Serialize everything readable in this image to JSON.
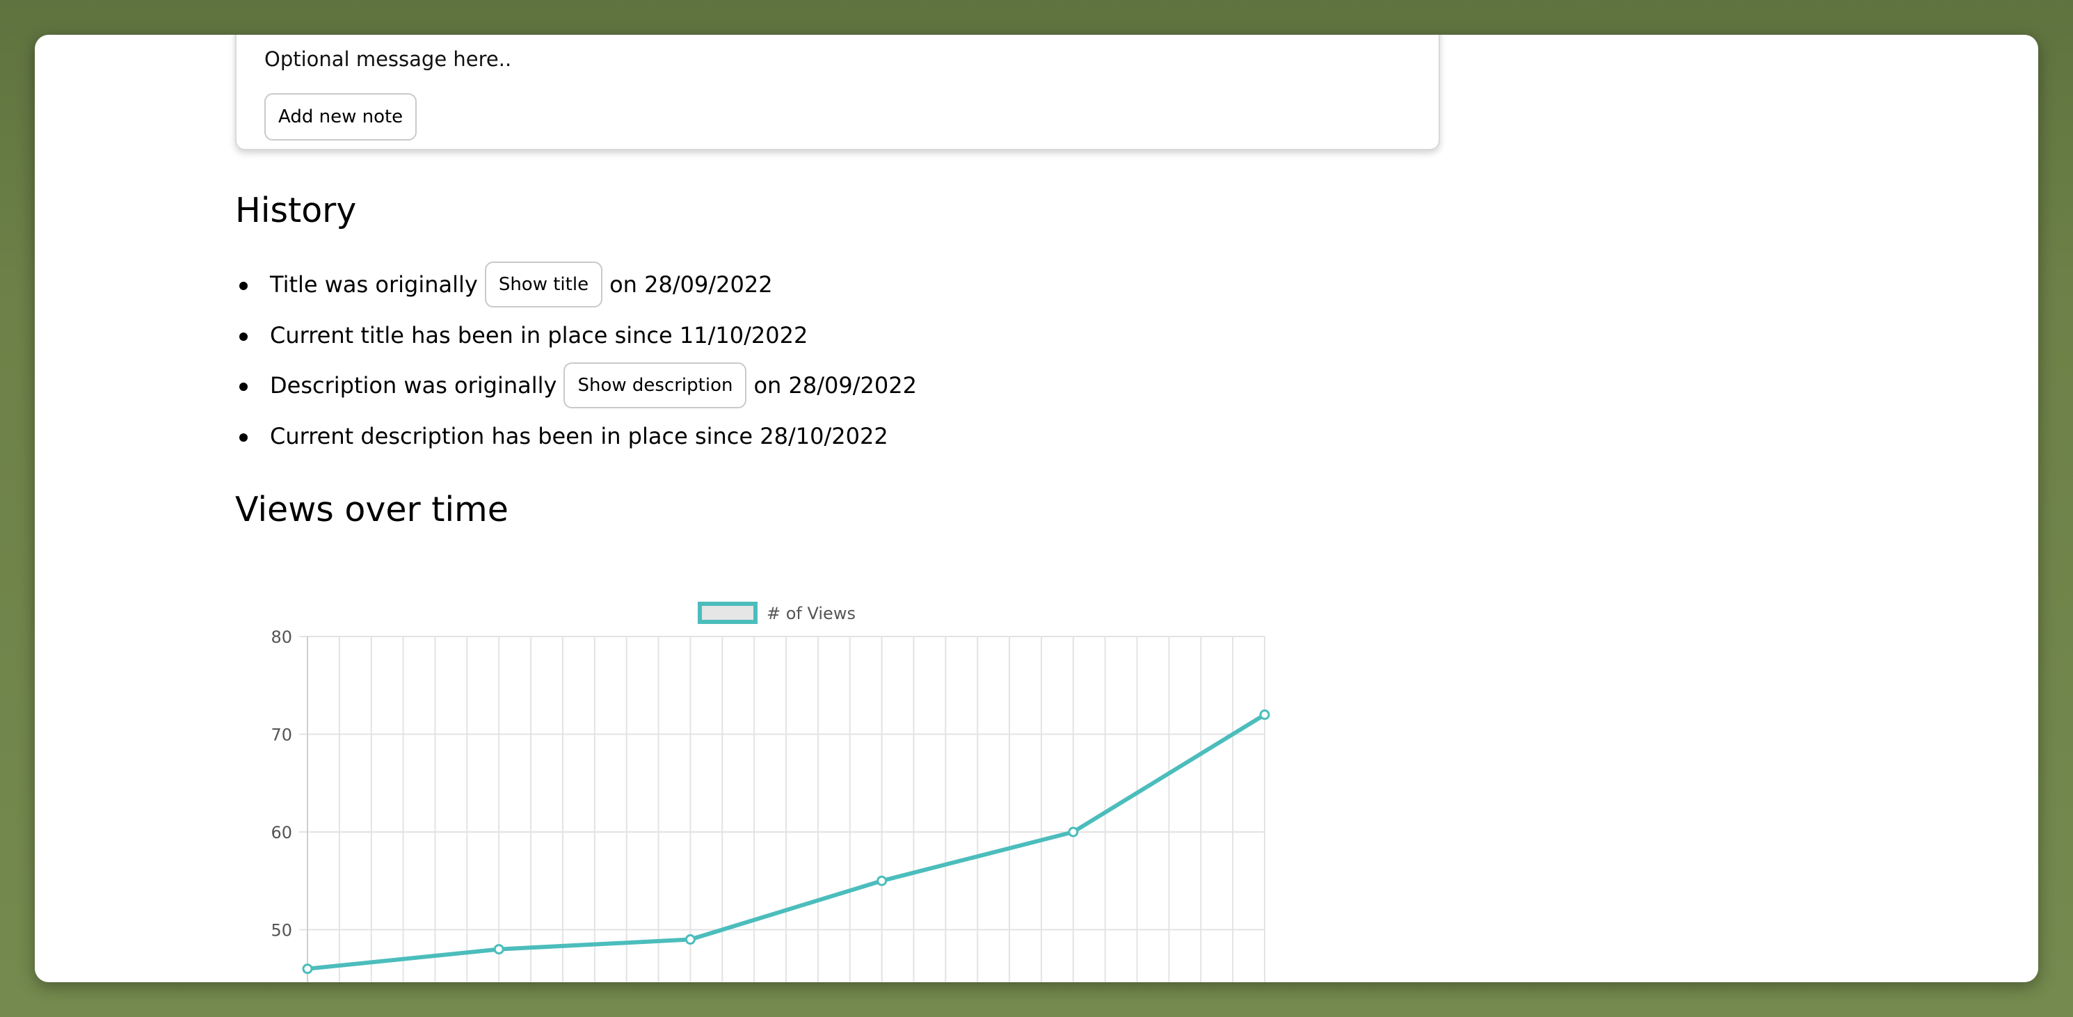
{
  "note": {
    "message": "Optional message here..",
    "add_button_label": "Add new note"
  },
  "history": {
    "title": "History",
    "items": [
      {
        "prefix": "Title was originally",
        "button": "Show title",
        "suffix": "on 28/09/2022"
      },
      {
        "text": "Current title has been in place since 11/10/2022"
      },
      {
        "prefix": "Description was originally",
        "button": "Show description",
        "suffix": "on 28/09/2022"
      },
      {
        "text": "Current description has been in place since 28/10/2022"
      }
    ]
  },
  "views": {
    "title": "Views over time"
  },
  "colors": {
    "series": "#4bbdbc",
    "grid": "#e3e3e3",
    "legend_fill": "#e6e6e6",
    "tick_text": "#555555"
  },
  "chart_data": {
    "type": "line",
    "legend": [
      "# of Views"
    ],
    "legend_position": "top-center",
    "grid": true,
    "ylim": [
      40,
      80
    ],
    "yticks": [
      50,
      60,
      70,
      80
    ],
    "x_count": 31,
    "series": [
      {
        "name": "# of Views",
        "points": [
          {
            "x": 0,
            "y": 46
          },
          {
            "x": 6,
            "y": 48
          },
          {
            "x": 12,
            "y": 49
          },
          {
            "x": 18,
            "y": 55
          },
          {
            "x": 24,
            "y": 60
          },
          {
            "x": 30,
            "y": 72
          }
        ]
      }
    ]
  }
}
